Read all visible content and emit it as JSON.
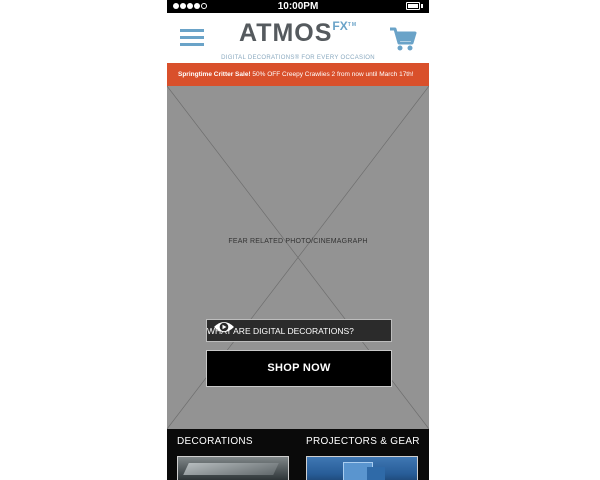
{
  "status_bar": {
    "time": "10:00PM"
  },
  "header": {
    "logo_main": "ATMOS",
    "logo_fx": "FX",
    "logo_tm": "TM",
    "tagline": "DIGITAL DECORATIONS® FOR EVERY OCCASION"
  },
  "promo": {
    "title": "Springtime Critter Sale!",
    "text": "50% OFF Creepy Crawlies 2 from now until March 17th!"
  },
  "hero": {
    "placeholder_label": "FEAR RELATED PHOTO/CINEMAGRAPH",
    "what_button_label": "WHAT ARE DIGITAL DECORATIONS?",
    "shop_button_label": "SHOP NOW"
  },
  "categories": [
    {
      "title": "DECORATIONS"
    },
    {
      "title": "PROJECTORS & GEAR"
    }
  ],
  "colors": {
    "accent_blue": "#6aa3c8",
    "promo_orange": "#d9502b",
    "placeholder_gray": "#939393"
  },
  "icons": [
    "menu-icon",
    "cart-icon",
    "eye-play-icon",
    "battery-icon",
    "signal-dots-icon"
  ]
}
